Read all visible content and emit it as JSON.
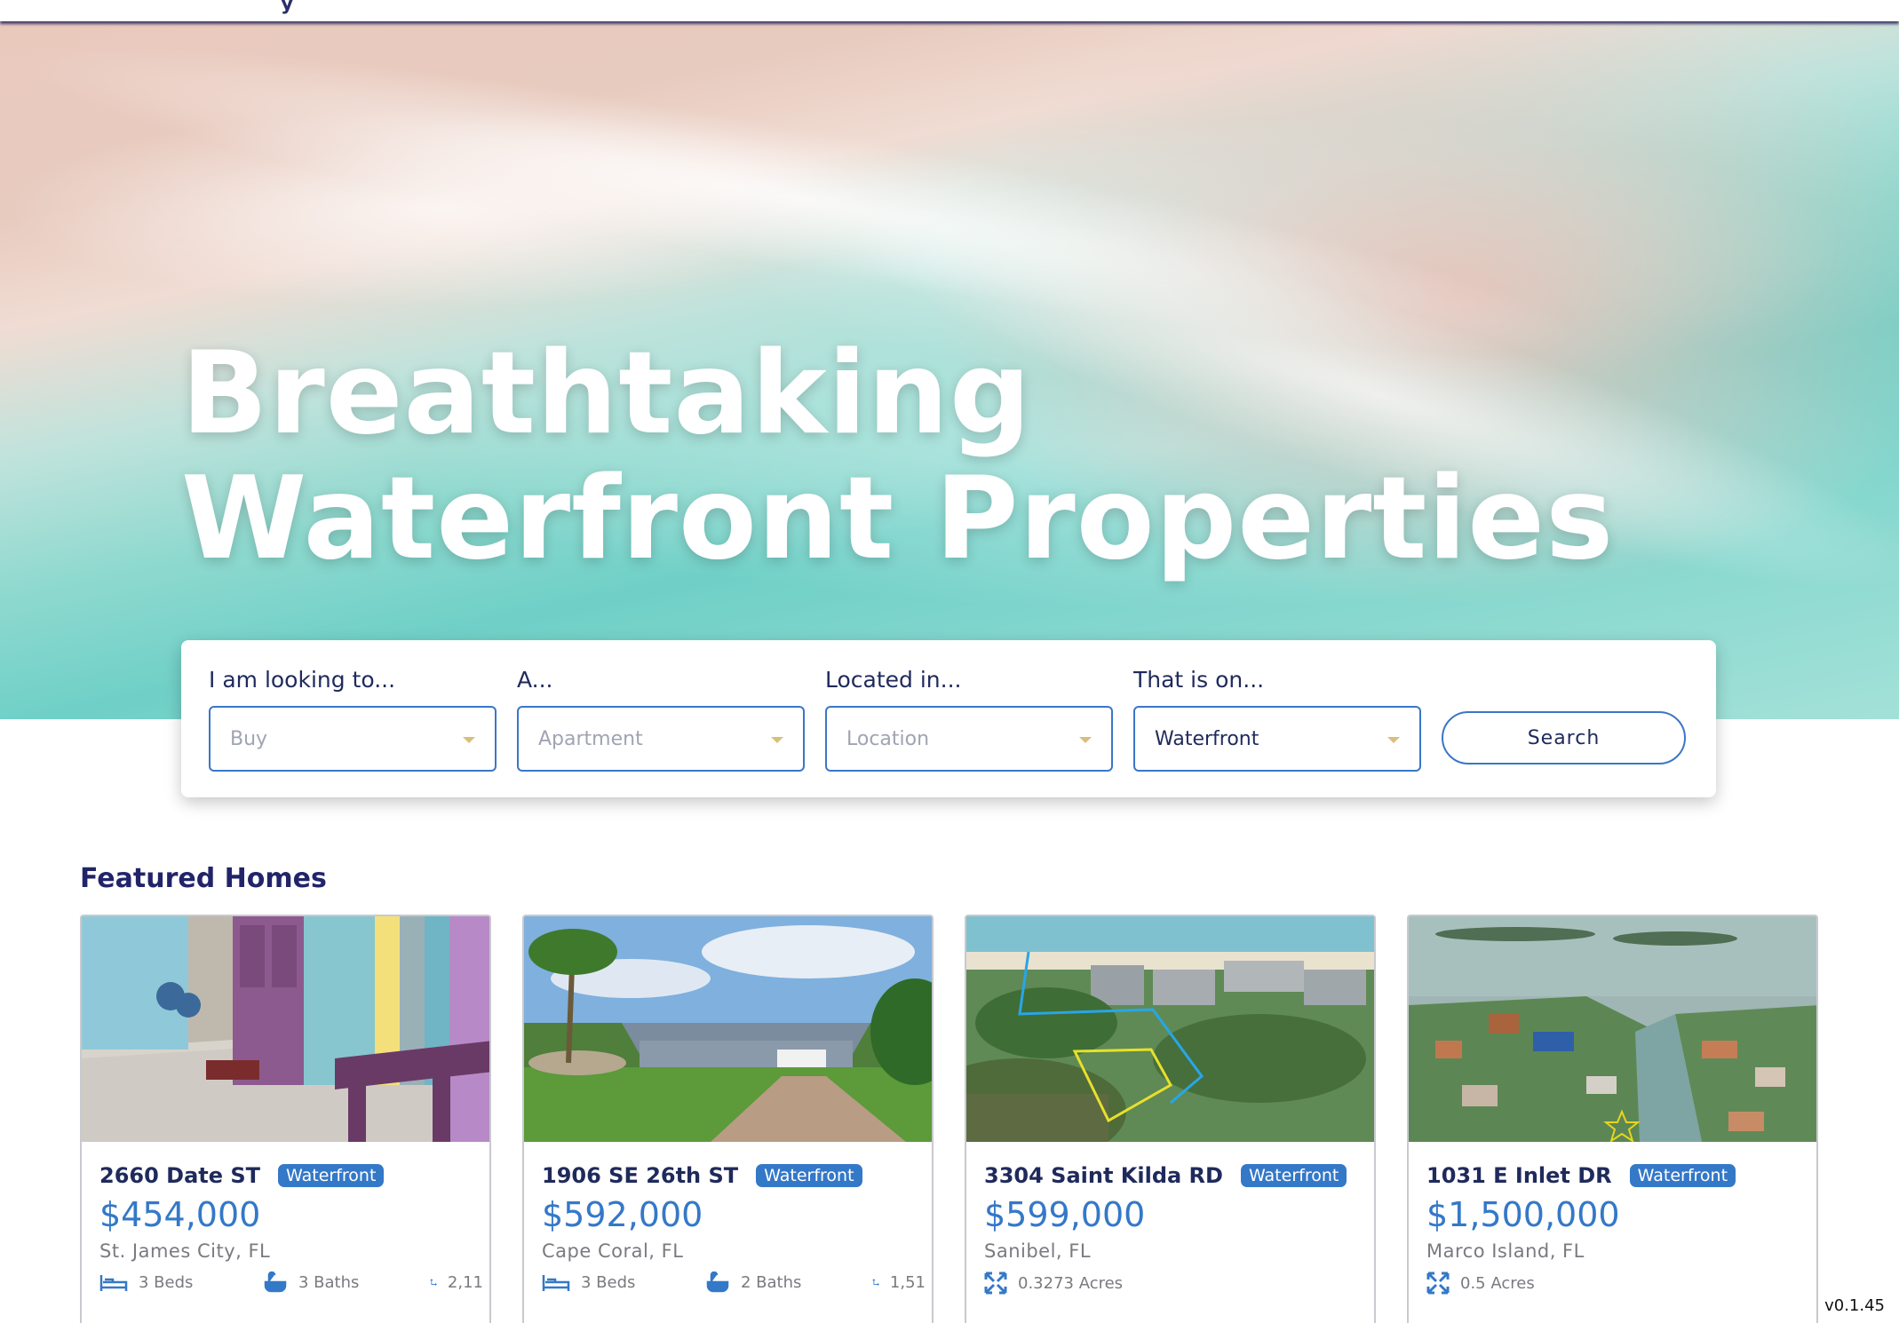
{
  "hero": {
    "title_line1": "Breathtaking",
    "title_line2": "Waterfront Properties"
  },
  "search": {
    "fields": [
      {
        "label": "I am looking to...",
        "value": "Buy",
        "is_placeholder": true
      },
      {
        "label": "A...",
        "value": "Apartment",
        "is_placeholder": true
      },
      {
        "label": "Located in...",
        "value": "Location",
        "is_placeholder": true
      },
      {
        "label": "That is on...",
        "value": "Waterfront",
        "is_placeholder": false
      }
    ],
    "button_label": "Search"
  },
  "featured": {
    "title": "Featured Homes",
    "cards": [
      {
        "address": "2660 Date ST",
        "badge": "Waterfront",
        "price": "$454,000",
        "city": "St. James City, FL",
        "beds": "3 Beds",
        "baths": "3 Baths",
        "sqft": "2,11"
      },
      {
        "address": "1906 SE 26th ST",
        "badge": "Waterfront",
        "price": "$592,000",
        "city": "Cape Coral, FL",
        "beds": "3 Beds",
        "baths": "2 Baths",
        "sqft": "1,51"
      },
      {
        "address": "3304 Saint Kilda RD",
        "badge": "Waterfront",
        "price": "$599,000",
        "city": "Sanibel, FL",
        "acres": "0.3273 Acres"
      },
      {
        "address": "1031 E Inlet DR",
        "badge": "Waterfront",
        "price": "$1,500,000",
        "city": "Marco Island, FL",
        "acres": "0.5 Acres"
      }
    ]
  },
  "footer": {
    "version": "v0.1.45"
  },
  "colors": {
    "accent": "#3478c8",
    "navy": "#1f2a5c",
    "caret": "#d8bf7c"
  }
}
